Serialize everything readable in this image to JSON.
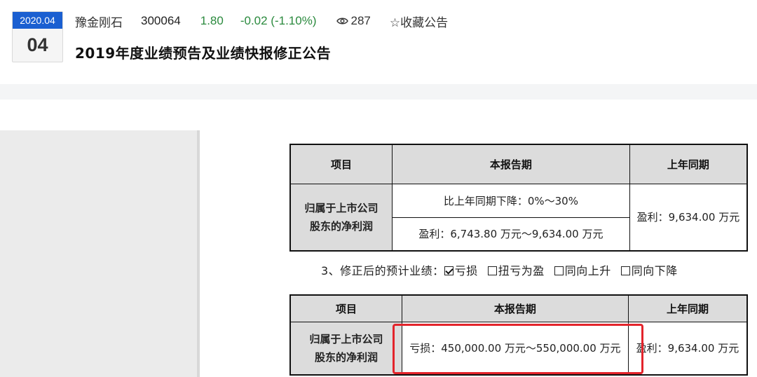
{
  "header": {
    "date_year_month": "2020.04",
    "date_day": "04",
    "stock_name": "豫金刚石",
    "stock_code": "300064",
    "price": "1.80",
    "change": "-0.02 (-1.10%)",
    "views": "287",
    "favorite_label": "☆收藏公告",
    "title": "2019年度业绩预告及业绩快报修正公告"
  },
  "colors": {
    "accent_blue": "#1a5fd1",
    "price_green": "#2b8a3e",
    "highlight_red": "#e3242b"
  },
  "table1": {
    "headers": [
      "项目",
      "本报告期",
      "上年同期"
    ],
    "row_label_line1": "归属于上市公司",
    "row_label_line2": "股东的净利润",
    "current_line1": "比上年同期下降：0%～30%",
    "current_line2": "盈利：6,743.80 万元～9,634.00 万元",
    "previous": "盈利：9,634.00 万元"
  },
  "revision": {
    "prefix": "3、修正后的预计业绩：",
    "options": [
      "亏损",
      "扭亏为盈",
      "同向上升",
      "同向下降"
    ],
    "checked_index": 0
  },
  "table2": {
    "headers": [
      "项目",
      "本报告期",
      "上年同期"
    ],
    "row_label_line1": "归属于上市公司",
    "row_label_line2": "股东的净利润",
    "current": "亏损：450,000.00  万元～550,000.00  万元",
    "previous": "盈利：9,634.00 万元"
  }
}
